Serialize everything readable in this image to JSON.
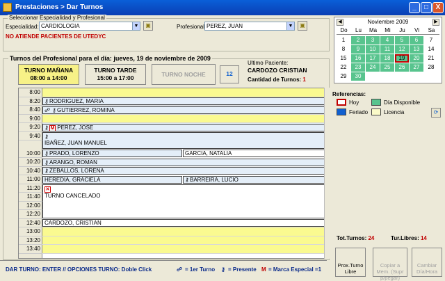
{
  "window": {
    "title": "Prestaciones > Dar Turnos",
    "controls": [
      "_",
      "□",
      "X"
    ]
  },
  "filters": {
    "group_title": "Seleccionar Especialidad y Profesional",
    "especialidad_label": "Especialidad:",
    "especialidad_value": "CARDIOLOGIA",
    "profesional_label": "Profesional:",
    "profesional_value": "PEREZ, JUAN",
    "warning": "NO ATIENDE PACIENTES DE UTEDYC"
  },
  "turnos": {
    "heading": "Turnos del Profesional para el día: jueves, 19 de noviembre de 2009",
    "shifts": [
      {
        "name": "TURNO MAÑANA",
        "hours": "08:00 a 14:00"
      },
      {
        "name": "TURNO TARDE",
        "hours": "15:00 a 17:00"
      },
      {
        "name": "TURNO NOCHE",
        "hours": ""
      }
    ],
    "calendar_btn_day": "12"
  },
  "last_patient": {
    "label": "Ultimo Paciente:",
    "name": "CARDOZO CRISTIAN",
    "count_label": "Cantidad de Turnos:",
    "count": "1"
  },
  "schedule": {
    "times": [
      "8:00",
      "8:20",
      "8:40",
      "9:00",
      "9:20",
      "9:40",
      "10:00",
      "10:20",
      "10:40",
      "11:00",
      "11:20",
      "11:40",
      "12:00",
      "12:20",
      "12:40",
      "13:00",
      "13:20",
      "13:40"
    ],
    "appointments": [
      {
        "name": "RODRIGUEZ, MARIA"
      },
      {
        "name": "GUTIERREZ, ROMINA"
      },
      {
        "name": "PEREZ, JOSE"
      },
      {
        "name": "IBAÑEZ, JUAN MANUEL"
      },
      {
        "name": "PRADO, LORENZO"
      },
      {
        "name": "GARCIA, NATALIA"
      },
      {
        "name": "ARANGO, ROMAN"
      },
      {
        "name": "ZEBALLOS, LORENA"
      },
      {
        "name": "HEREDIA, GRACIELA"
      },
      {
        "name": "BARREIRA, LUCIO"
      },
      {
        "name": "TURNO CANCELADO"
      },
      {
        "name": "CARDOZO, CRISTIAN"
      }
    ]
  },
  "calendar": {
    "month": "Noviembre 2009",
    "weekdays": [
      "Do",
      "Lu",
      "Ma",
      "Mi",
      "Ju",
      "Vi",
      "Sa"
    ],
    "days": [
      "1",
      "2",
      "3",
      "4",
      "5",
      "6",
      "7",
      "8",
      "9",
      "10",
      "11",
      "12",
      "13",
      "14",
      "15",
      "16",
      "17",
      "18",
      "19",
      "20",
      "21",
      "22",
      "23",
      "24",
      "25",
      "26",
      "27",
      "28",
      "29",
      "30"
    ],
    "available_color": "#58c48e",
    "today_color": "#c00000"
  },
  "references": {
    "title": "Referencias:",
    "items": [
      {
        "label": "Hoy",
        "color": "#ffffff"
      },
      {
        "label": "Día Disponible",
        "color": "#58c48e"
      },
      {
        "label": "Feriado",
        "color": "#1060d0"
      },
      {
        "label": "Licencia",
        "color": "#fafac8"
      }
    ]
  },
  "totals": {
    "tot_label": "Tot.Turnos:",
    "tot_value": "24",
    "libres_label": "Tur.Libres:",
    "libres_value": "14"
  },
  "footer": {
    "hint": "DAR TURNO: ENTER // OPCIONES TURNO: Doble Click",
    "legend_first": "= 1er Turno",
    "legend_present": "= Presente",
    "legend_mark_key": "M",
    "legend_mark": "= Marca Especial =1"
  },
  "actions": [
    {
      "label": "Prox.Turno Libre"
    },
    {
      "label": "Copiar a Mem. (Supr p/pegar)"
    },
    {
      "label": "Cambiar Día/Hora"
    }
  ]
}
